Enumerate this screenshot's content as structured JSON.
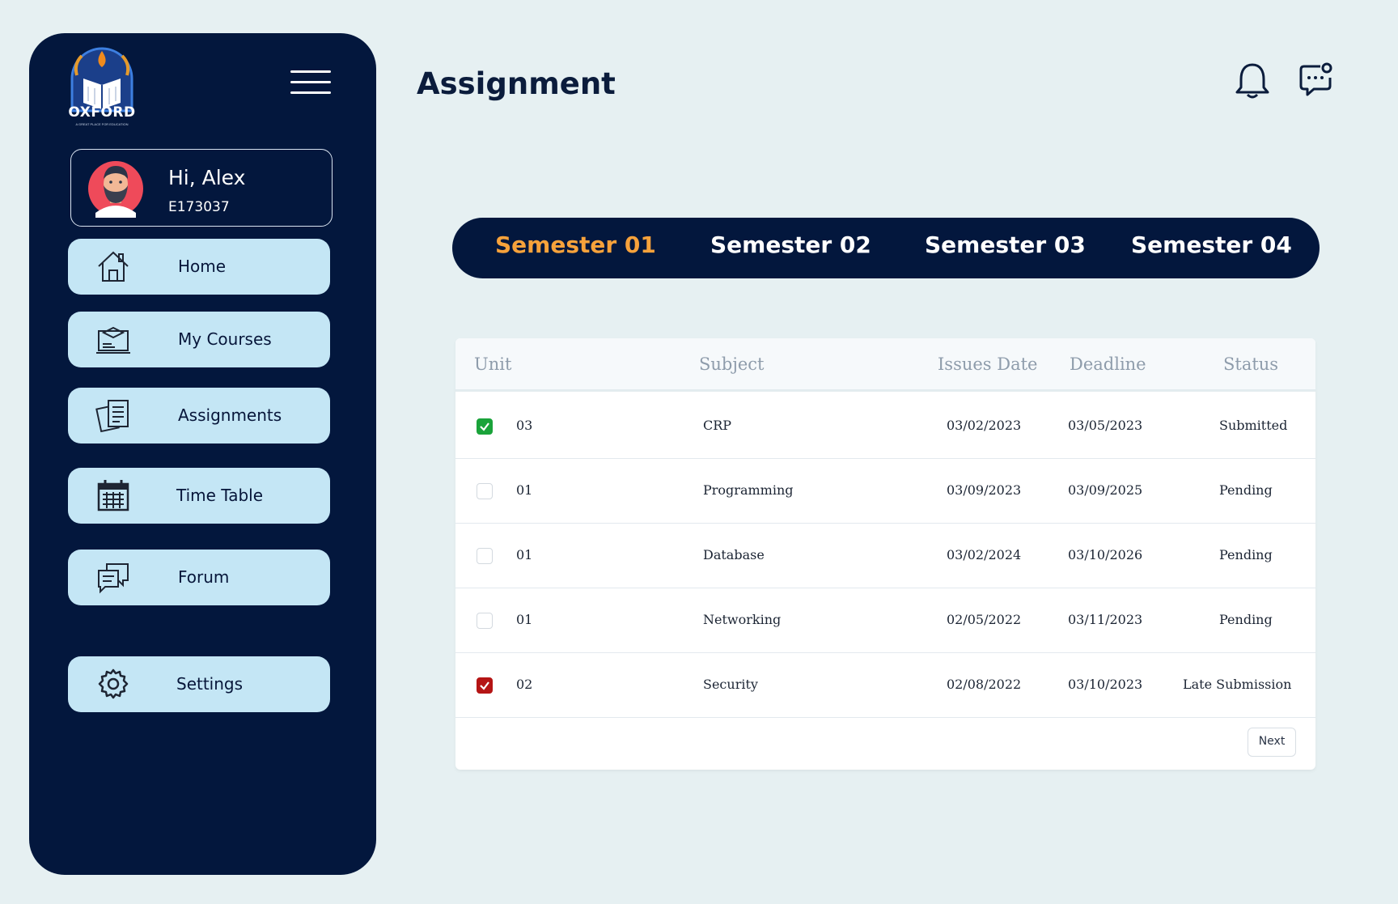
{
  "sidebar": {
    "logo": {
      "text": "OXFORD",
      "tagline": "A GREAT PLACE FOR EDUCATION"
    },
    "profile": {
      "greeting": "Hi, Alex",
      "id": "E173037"
    },
    "nav": [
      {
        "label": "Home",
        "icon": "home-icon"
      },
      {
        "label": "My Courses",
        "icon": "courses-icon"
      },
      {
        "label": "Assignments",
        "icon": "assignments-icon"
      },
      {
        "label": "Time Table",
        "icon": "calendar-icon"
      },
      {
        "label": "Forum",
        "icon": "forum-icon"
      },
      {
        "label": "Settings",
        "icon": "gear-icon"
      }
    ]
  },
  "header": {
    "title": "Assignment",
    "icons": [
      "bell-icon",
      "chat-icon"
    ]
  },
  "tabs": {
    "items": [
      "Semester 01",
      "Semester 02",
      "Semester 03",
      "Semester 04"
    ],
    "active": "Semester 01"
  },
  "table": {
    "columns": [
      "Unit",
      "Subject",
      "Issues Date",
      "Deadline",
      "Status"
    ],
    "rows": [
      {
        "checked": "green",
        "unit": "03",
        "subject": "CRP",
        "issued": "03/02/2023",
        "deadline": "03/05/2023",
        "status": "Submitted"
      },
      {
        "checked": "none",
        "unit": "01",
        "subject": "Programming",
        "issued": "03/09/2023",
        "deadline": "03/09/2025",
        "status": "Pending"
      },
      {
        "checked": "none",
        "unit": "01",
        "subject": "Database",
        "issued": "03/02/2024",
        "deadline": "03/10/2026",
        "status": "Pending"
      },
      {
        "checked": "none",
        "unit": "01",
        "subject": "Networking",
        "issued": "02/05/2022",
        "deadline": "03/11/2023",
        "status": "Pending"
      },
      {
        "checked": "red",
        "unit": "02",
        "subject": "Security",
        "issued": "02/08/2022",
        "deadline": "03/10/2023",
        "status": "Late Submission"
      }
    ],
    "next_label": "Next"
  },
  "colors": {
    "navy": "#03173d",
    "accent": "#f7a23b",
    "nav_bg": "#c4e6f5",
    "page_bg": "#e6f0f2",
    "checked_green": "#1aa33a",
    "checked_red": "#b51515"
  }
}
